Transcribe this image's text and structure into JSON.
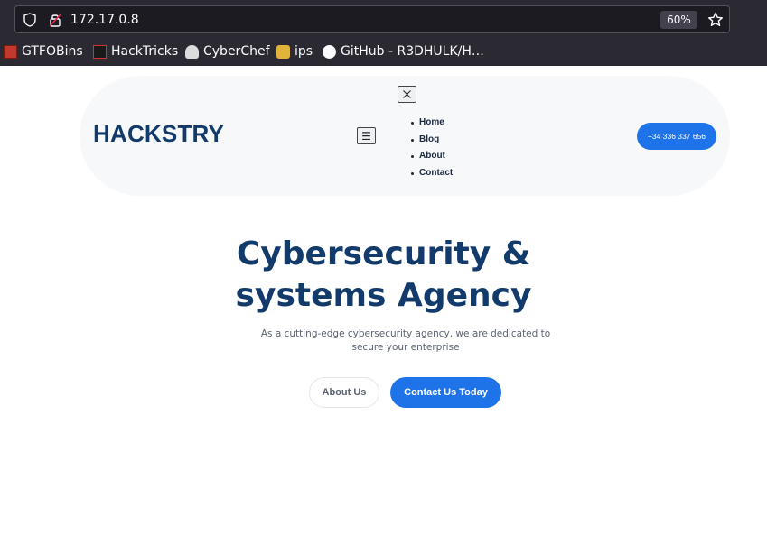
{
  "browser": {
    "url": "172.17.0.8",
    "zoom": "60%",
    "bookmarks": [
      {
        "label": "GTFOBins",
        "icon": "gtfobins-icon"
      },
      {
        "label": "HackTricks",
        "icon": "hacktricks-icon"
      },
      {
        "label": "CyberChef",
        "icon": "cyberchef-icon"
      },
      {
        "label": "ips",
        "icon": "ips-icon"
      },
      {
        "label": "GitHub - R3DHULK/H…",
        "icon": "github-icon"
      }
    ]
  },
  "nav": {
    "logo": "HACKSTRY",
    "hamburger": "☰",
    "menu": [
      "Home",
      "Blog",
      "About",
      "Contact"
    ],
    "phone": "+34 336 337 656"
  },
  "hero": {
    "title_line1": "Cybersecurity &",
    "title_line2": "systems Agency",
    "subtitle": "As a cutting-edge cybersecurity agency, we are dedicated to secure your enterprise",
    "about_btn": "About Us",
    "contact_btn": "Contact Us Today"
  },
  "colors": {
    "brand": "#123a6b",
    "accent": "#1f73e8",
    "chrome_bg": "#2b2a33"
  }
}
